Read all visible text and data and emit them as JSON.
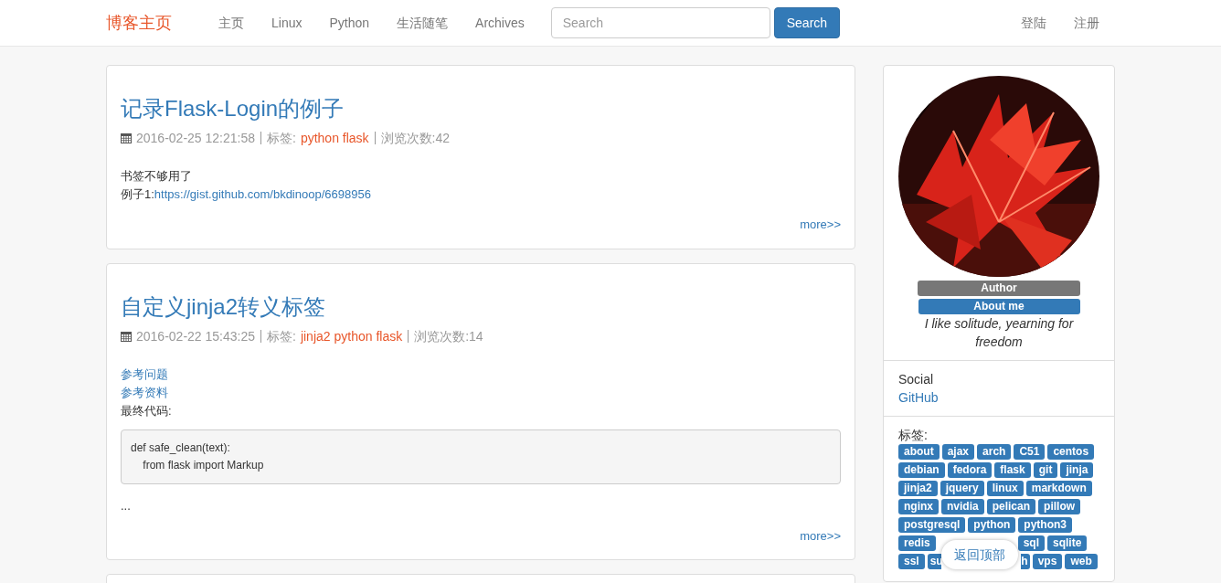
{
  "navbar": {
    "brand": "博客主页",
    "links": [
      "主页",
      "Linux",
      "Python",
      "生活随笔",
      "Archives"
    ],
    "search": {
      "placeholder": "Search"
    },
    "search_button": "Search",
    "user_links": [
      "登陆",
      "注册"
    ]
  },
  "posts": [
    {
      "title": "记录Flask-Login的例子",
      "date": "2016-02-25 12:21:58",
      "tags_label": "标签:",
      "tags": "python flask",
      "views": "浏览次数:42",
      "body": [
        {
          "kind": "text",
          "text": "书签不够用了"
        },
        {
          "kind": "text_link",
          "text": "例子1:",
          "link": "https://gist.github.com/bkdinoop/6698956"
        }
      ],
      "more": "more>>"
    },
    {
      "title": "自定义jinja2转义标签",
      "date": "2016-02-22 15:43:25",
      "tags_label": "标签:",
      "tags": "jinja2 python flask",
      "views": "浏览次数:14",
      "body": [
        {
          "kind": "link",
          "text": "参考问题"
        },
        {
          "kind": "link",
          "text": "参考资料"
        },
        {
          "kind": "text",
          "text": "最终代码:"
        },
        {
          "kind": "code",
          "lines": [
            "def safe_clean(text):",
            "    from flask import Markup"
          ]
        },
        {
          "kind": "text",
          "text": "..."
        }
      ],
      "more": "more>>"
    }
  ],
  "sidebar": {
    "author_badge": "Author",
    "about_button": "About me",
    "motto": "I like solitude, yearning for freedom",
    "social_heading": "Social",
    "social_links": [
      "GitHub"
    ],
    "tags_heading": "标签:",
    "tags": [
      {
        "kind": "tag",
        "label": "about"
      },
      {
        "kind": "tag",
        "label": "ajax"
      },
      {
        "kind": "tag",
        "label": "arch"
      },
      {
        "kind": "tag",
        "label": "C51"
      },
      {
        "kind": "tag",
        "label": "centos"
      },
      {
        "kind": "tag",
        "label": "debian"
      },
      {
        "kind": "tag",
        "label": "fedora"
      },
      {
        "kind": "tag",
        "label": "flask"
      },
      {
        "kind": "tag",
        "label": "git"
      },
      {
        "kind": "tag",
        "label": "jinja"
      },
      {
        "kind": "tag",
        "label": "jinja2"
      },
      {
        "kind": "tag",
        "label": "jquery"
      },
      {
        "kind": "tag",
        "label": "linux"
      },
      {
        "kind": "tag",
        "label": "markdown"
      },
      {
        "kind": "tag",
        "label": "nginx"
      },
      {
        "kind": "tag",
        "label": "nvidia"
      },
      {
        "kind": "tag",
        "label": "pelican"
      },
      {
        "kind": "tag",
        "label": "pillow"
      },
      {
        "kind": "tag",
        "label": "postgresql"
      },
      {
        "kind": "tag",
        "label": "python"
      },
      {
        "kind": "tag",
        "label": "python3"
      },
      {
        "kind": "tag",
        "label": "redis"
      },
      {
        "kind": "covered"
      },
      {
        "kind": "tag",
        "label": "sql"
      },
      {
        "kind": "tag",
        "label": "sqlite"
      },
      {
        "kind": "tag",
        "label": "ssl"
      },
      {
        "kind": "partial_start",
        "label": "su"
      },
      {
        "kind": "partial_end",
        "label": "h"
      },
      {
        "kind": "tag",
        "label": "vps"
      },
      {
        "kind": "tag",
        "label": "web"
      }
    ]
  },
  "back_to_top": "返回顶部"
}
